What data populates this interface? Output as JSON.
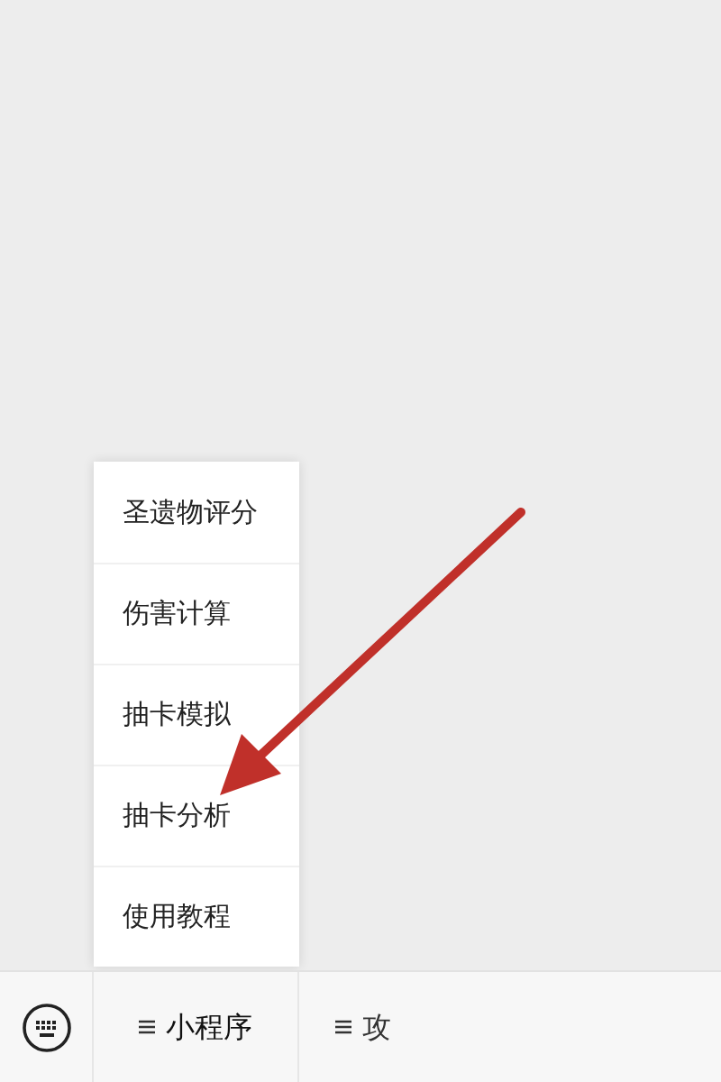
{
  "popup_menu": {
    "items": [
      {
        "label": "圣遗物评分"
      },
      {
        "label": "伤害计算"
      },
      {
        "label": "抽卡模拟"
      },
      {
        "label": "抽卡分析"
      },
      {
        "label": "使用教程"
      }
    ]
  },
  "bottom_bar": {
    "menus": [
      {
        "label": "小程序",
        "open": true
      },
      {
        "label": "攻",
        "open": false
      }
    ]
  }
}
